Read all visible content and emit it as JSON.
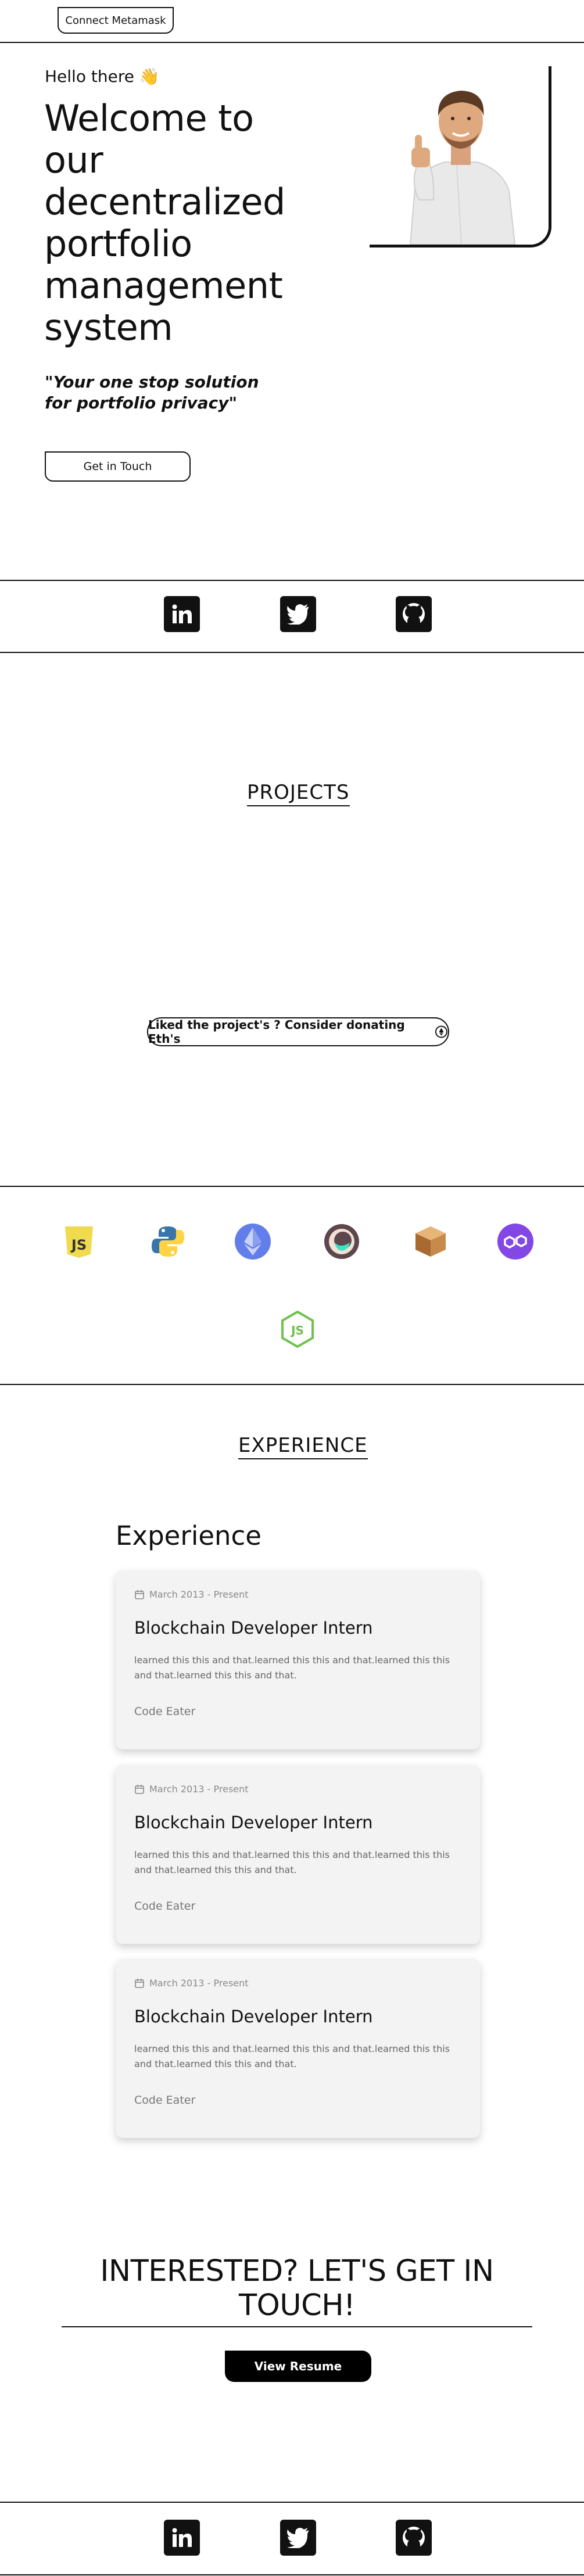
{
  "header": {
    "connect_label": "Connect Metamask"
  },
  "hero": {
    "greeting": "Hello there 👋",
    "title": "Welcome to our decentralized portfolio management system",
    "tagline": "\"Your one stop solution for portfolio privacy\"",
    "cta_label": "Get in Touch"
  },
  "socials": [
    {
      "name": "linkedin",
      "icon": "linkedin-icon"
    },
    {
      "name": "twitter",
      "icon": "twitter-icon"
    },
    {
      "name": "github",
      "icon": "github-icon"
    }
  ],
  "projects": {
    "title": "PROJECTS",
    "donate_label": "Liked the project's ? Consider donating Eth's"
  },
  "tech_stack": [
    {
      "name": "javascript",
      "icon": "javascript-icon",
      "label": "JS",
      "color": "#f0db4f"
    },
    {
      "name": "python",
      "icon": "python-icon",
      "color": "#3776ab"
    },
    {
      "name": "ethereum",
      "icon": "ethereum-icon",
      "color": "#627eea"
    },
    {
      "name": "ganache",
      "icon": "ganache-icon",
      "color": "#5e464d"
    },
    {
      "name": "truffle",
      "icon": "truffle-icon",
      "color": "#c88a4a"
    },
    {
      "name": "polygon",
      "icon": "polygon-icon",
      "color": "#8247e5"
    },
    {
      "name": "nodejs",
      "icon": "nodejs-icon",
      "label": "JS",
      "color": "#6cc24a"
    }
  ],
  "experience": {
    "section_title": "EXPERIENCE",
    "heading": "Experience",
    "items": [
      {
        "date": "March 2013 - Present",
        "role": "Blockchain Developer Intern",
        "description": "learned this this and that.learned this this and that.learned this this and that.learned this this and that.",
        "company": "Code Eater"
      },
      {
        "date": "March 2013 - Present",
        "role": "Blockchain Developer Intern",
        "description": "learned this this and that.learned this this and that.learned this this and that.learned this this and that.",
        "company": "Code Eater"
      },
      {
        "date": "March 2013 - Present",
        "role": "Blockchain Developer Intern",
        "description": "learned this this and that.learned this this and that.learned this this and that.learned this this and that.",
        "company": "Code Eater"
      }
    ]
  },
  "contact": {
    "title": "INTERESTED? LET'S GET IN TOUCH!",
    "resume_label": "View Resume"
  },
  "colors": {
    "accent": "#111111",
    "card_bg": "#f3f3f3",
    "muted_text": "#777777"
  }
}
